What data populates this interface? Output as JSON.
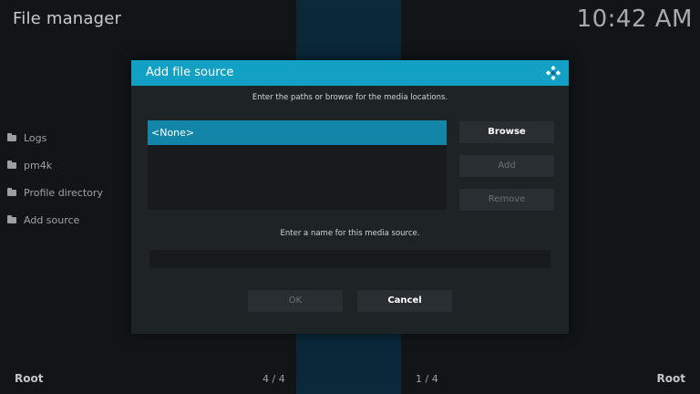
{
  "header": {
    "title": "File manager",
    "clock": "10:42 AM"
  },
  "sidebar": {
    "items": [
      {
        "label": "Logs",
        "icon": "folder-icon"
      },
      {
        "label": "pm4k",
        "icon": "folder-icon"
      },
      {
        "label": "Profile directory",
        "icon": "folder-icon"
      },
      {
        "label": "Add source",
        "icon": "folder-icon"
      }
    ]
  },
  "footer": {
    "left_label": "Root",
    "left_count": "4 / 4",
    "right_count": "1 / 4",
    "right_label": "Root"
  },
  "dialog": {
    "title": "Add file source",
    "icon": "kodi-icon",
    "paths_instruction": "Enter the paths or browse for the media locations.",
    "paths": [
      "<None>"
    ],
    "buttons": {
      "browse": "Browse",
      "add": "Add",
      "remove": "Remove",
      "ok": "OK",
      "cancel": "Cancel"
    },
    "name_instruction": "Enter a name for this media source.",
    "name_value": ""
  },
  "colors": {
    "accent": "#12a0c4",
    "selected_row": "#1285a8",
    "dialog_bg": "#1e2326",
    "page_bg": "#111517"
  }
}
